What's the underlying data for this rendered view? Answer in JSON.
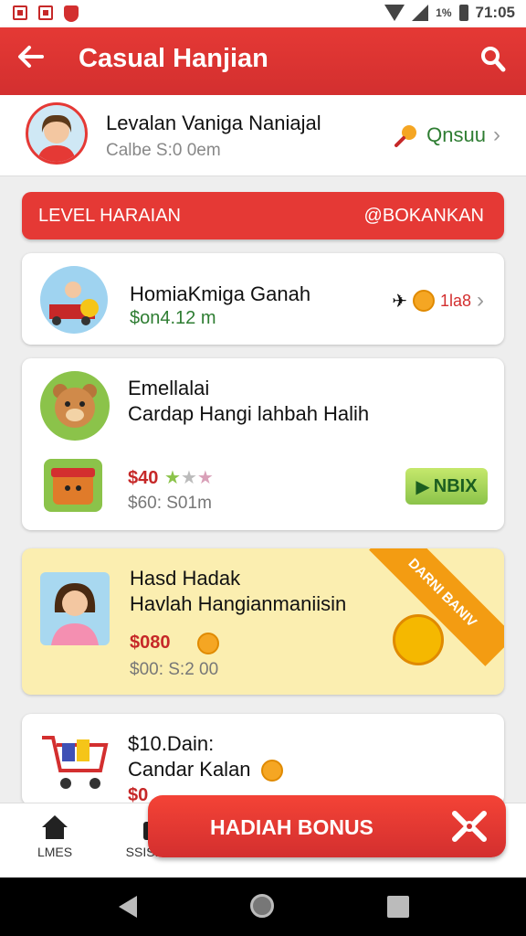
{
  "status": {
    "time": "71:05",
    "battery": "1%"
  },
  "appbar": {
    "title": "Casual Hanjian"
  },
  "profile": {
    "name": "Levalan Vaniga Naniajal",
    "subtitle": "Calbe S:0 0em",
    "bonus_label": "Qnsuu"
  },
  "level_bar": {
    "left": "LEVEL HARAIAN",
    "right": "@BOKANKAN"
  },
  "cards": [
    {
      "title": "HomiaKmiga Ganah",
      "price": "$on4.12 m",
      "tag": "1la8"
    },
    {
      "title1": "Emellalai",
      "title2": "Cardap Hangi lahbah Halih",
      "price_red": "$40",
      "price_grey": "$60: S01m",
      "button": "NBIX"
    },
    {
      "title1": "Hasd Hadak",
      "title2": "Havlah Hangianmaniisin",
      "price_red": "$080",
      "price_grey": "$00: S:2 00",
      "ribbon": "DARNI BANIV"
    },
    {
      "title1": "$10.Dain:",
      "title2": "Candar Kalan",
      "price_red": "$0"
    }
  ],
  "bottom_nav": [
    {
      "label": "LMES"
    },
    {
      "label": "SSISIDIO"
    }
  ],
  "bonus_button": {
    "label": "HADIAH BONUS"
  },
  "colors": {
    "primary": "#e53935",
    "accent_green": "#2e7d32",
    "highlight": "#fbeeb0"
  }
}
